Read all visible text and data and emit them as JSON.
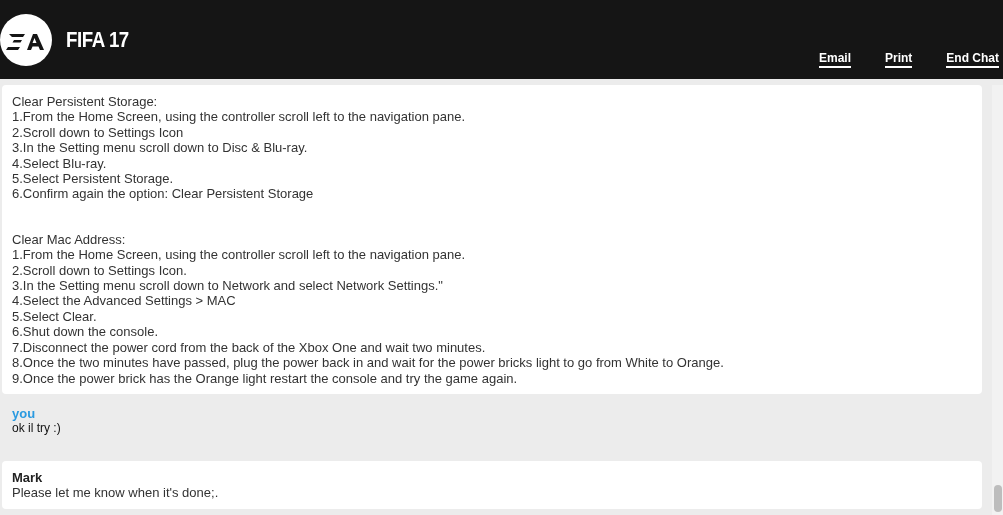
{
  "header": {
    "title": "FIFA 17",
    "links": [
      "Email",
      "Print",
      "End Chat"
    ]
  },
  "messages": [
    {
      "kind": "agent",
      "paragraphs": [
        [
          "Clear Persistent Storage:",
          "1.From the Home Screen, using the controller scroll left to the navigation pane.",
          "2.Scroll down to Settings Icon",
          "3.In the Setting menu scroll down to Disc & Blu-ray.",
          "4.Select Blu-ray.",
          "5.Select Persistent Storage.",
          "6.Confirm again the option: Clear Persistent Storage"
        ],
        [
          "Clear Mac Address:",
          "1.From the Home Screen, using the controller scroll left to the navigation pane.",
          "2.Scroll down to Settings Icon.",
          "3.In the Setting menu scroll down to Network and select Network Settings.\"",
          "4.Select the Advanced Settings > MAC",
          "5.Select Clear.",
          "6.Shut down the console.",
          "7.Disconnect the power cord from the back of the Xbox One and wait two minutes.",
          "8.Once the two minutes have passed, plug the power back in and wait for the power bricks light to go from White to Orange.",
          "9.Once the power brick has the Orange light restart the console and try the game again."
        ]
      ]
    },
    {
      "kind": "user",
      "sender": "you",
      "paragraphs": [
        [
          "ok il try :)"
        ]
      ]
    },
    {
      "kind": "agent",
      "sender": "Mark",
      "paragraphs": [
        [
          "Please let me know when it's done;."
        ]
      ]
    }
  ]
}
